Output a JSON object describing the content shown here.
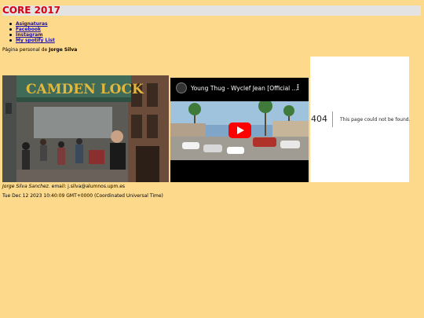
{
  "header": {
    "title": "CORE 2017"
  },
  "nav": {
    "items": [
      {
        "label": "Asignaturas"
      },
      {
        "label": "Facebook"
      },
      {
        "label": "Instagram"
      },
      {
        "label": "My spotify List"
      }
    ]
  },
  "intro": {
    "prefix": "Página personal de ",
    "name": "Jorge Silva"
  },
  "photo": {
    "sign_text": "CAMDEN LOCK"
  },
  "video": {
    "title": "Young Thug - Wyclef Jean [Official ...",
    "menu_glyph": "⋮",
    "play_icon": "youtube-play-icon"
  },
  "error_frame": {
    "code": "404",
    "message": "This page could not be found."
  },
  "caption": {
    "author": "Jorge Silva Sanchez",
    "email_text": ". email: j.silva@alumnos.upm.es"
  },
  "datetime": {
    "text": "Tue Dec 12 2023 10:40:09 GMT+0000 (Coordinated Universal Time)"
  },
  "colors": {
    "background": "#FDD98C",
    "title": "#D8000F",
    "header_bar": "#E3E3E3",
    "link": "#1a0dab"
  }
}
